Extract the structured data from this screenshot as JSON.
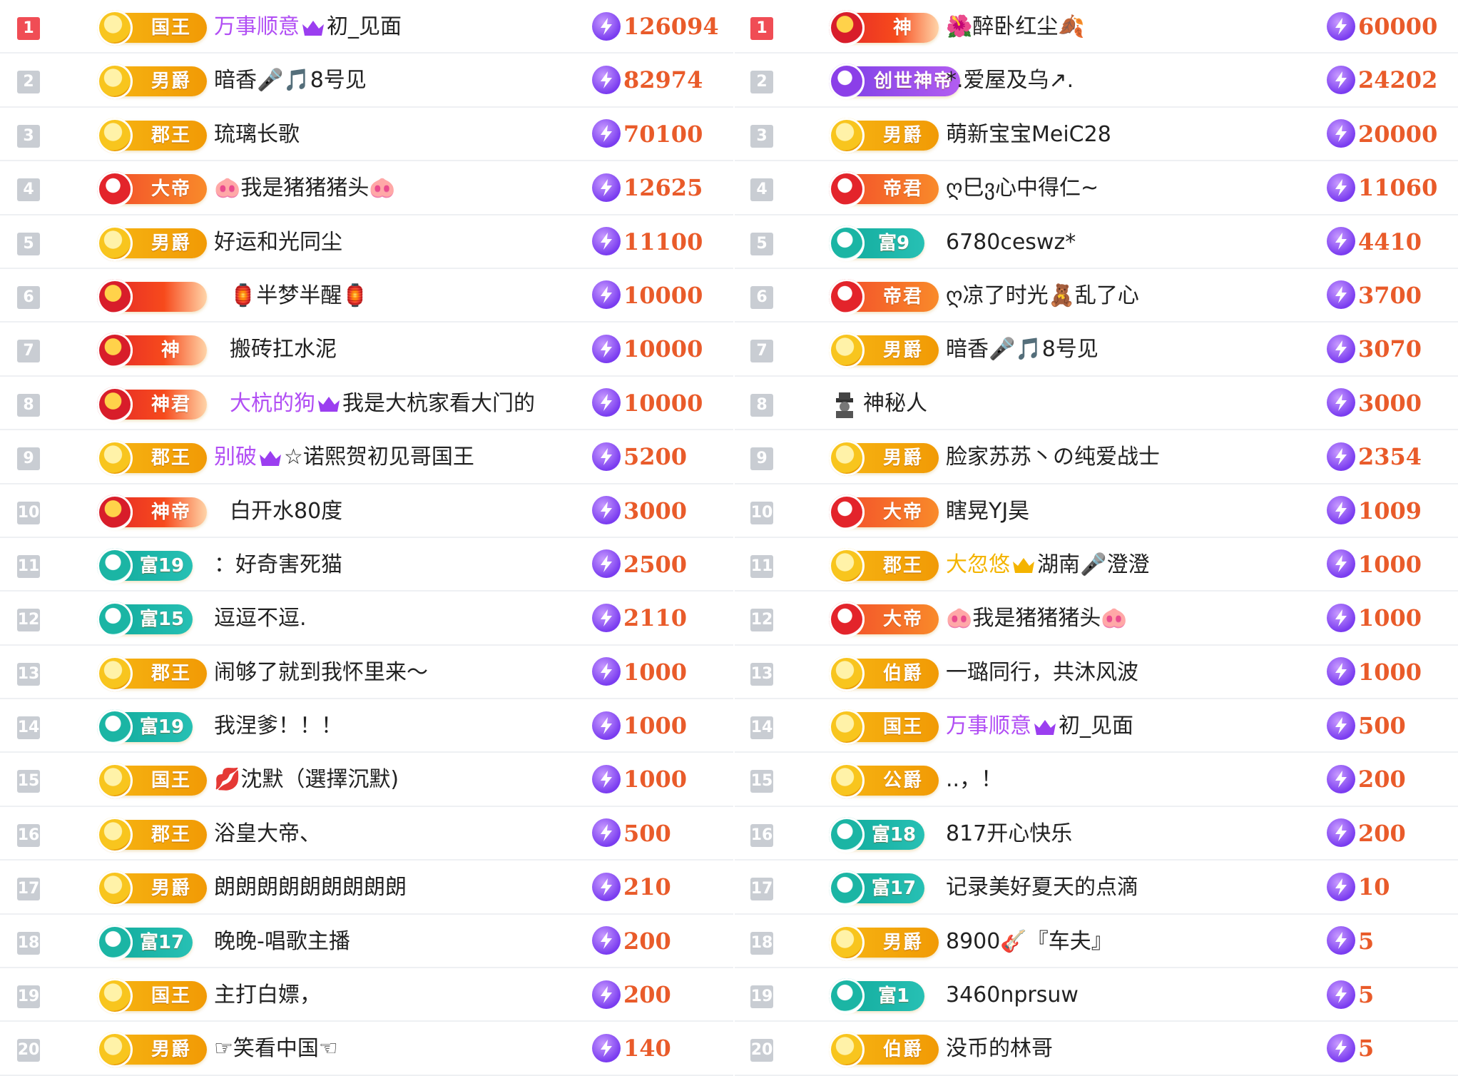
{
  "left": [
    {
      "rank": "1",
      "badge": "国王",
      "style": "gold",
      "name": "初_见面",
      "prefix": "万事顺意",
      "crown": true,
      "score": "126094",
      "top": true
    },
    {
      "rank": "2",
      "badge": "男爵",
      "style": "gold",
      "name": "暗香🎤🎵8号见",
      "score": "82974"
    },
    {
      "rank": "3",
      "badge": "郡王",
      "style": "gold",
      "name": "琉璃长歌",
      "score": "70100"
    },
    {
      "rank": "4",
      "badge": "大帝",
      "style": "red",
      "name": "🐽我是猪猪猪头🐽",
      "score": "12625"
    },
    {
      "rank": "5",
      "badge": "男爵",
      "style": "gold",
      "name": "好运和光同尘",
      "score": "11100"
    },
    {
      "rank": "6",
      "badge": "",
      "style": "red2",
      "name": "🏮半梦半醒🏮",
      "score": "10000",
      "shift": true
    },
    {
      "rank": "7",
      "badge": "神",
      "style": "red2",
      "name": "搬砖扛水泥",
      "score": "10000",
      "shift": true
    },
    {
      "rank": "8",
      "badge": "神君",
      "style": "red2",
      "name": "我是大杭家看大门的",
      "prefix": "大杭的狗",
      "crown": true,
      "score": "10000",
      "shift": true
    },
    {
      "rank": "9",
      "badge": "郡王",
      "style": "gold",
      "name": "☆诺熙贺初见哥国王",
      "prefix": "别破",
      "crown": true,
      "score": "5200"
    },
    {
      "rank": "10",
      "badge": "神帝",
      "style": "red2",
      "name": "白开水80度",
      "score": "3000",
      "shift": true
    },
    {
      "rank": "11",
      "badge": "富19",
      "style": "green",
      "name": "：好奇害死猫",
      "score": "2500"
    },
    {
      "rank": "12",
      "badge": "富15",
      "style": "green",
      "name": "逗逗不逗.",
      "score": "2110"
    },
    {
      "rank": "13",
      "badge": "郡王",
      "style": "gold",
      "name": "闹够了就到我怀里来～",
      "score": "1000"
    },
    {
      "rank": "14",
      "badge": "富19",
      "style": "green",
      "name": "我涅爹！！！",
      "score": "1000"
    },
    {
      "rank": "15",
      "badge": "国王",
      "style": "gold",
      "name": "💋沈默（選擇沉默)",
      "score": "1000"
    },
    {
      "rank": "16",
      "badge": "郡王",
      "style": "gold",
      "name": "浴皇大帝、",
      "score": "500"
    },
    {
      "rank": "17",
      "badge": "男爵",
      "style": "gold",
      "name": "朗朗朗朗朗朗朗朗朗",
      "score": "210"
    },
    {
      "rank": "18",
      "badge": "富17",
      "style": "green",
      "name": "晚晚-唱歌主播",
      "score": "200"
    },
    {
      "rank": "19",
      "badge": "国王",
      "style": "gold",
      "name": "主打白嫖，",
      "score": "200"
    },
    {
      "rank": "20",
      "badge": "男爵",
      "style": "gold",
      "name": "☞笑看中国☜",
      "score": "140"
    }
  ],
  "right": [
    {
      "rank": "1",
      "badge": "神",
      "style": "red2",
      "name": "🌺醉卧红尘🍂",
      "score": "60000",
      "top": true,
      "shift": true
    },
    {
      "rank": "2",
      "badge": "创世神帝",
      "style": "purple",
      "name": "*.爱屋及乌↗.",
      "score": "24202",
      "shift": true
    },
    {
      "rank": "3",
      "badge": "男爵",
      "style": "gold",
      "name": "萌新宝宝MeiC28",
      "score": "20000"
    },
    {
      "rank": "4",
      "badge": "帝君",
      "style": "red",
      "name": "ღ巳ვ心中得仁~",
      "score": "11060"
    },
    {
      "rank": "5",
      "badge": "富9",
      "style": "green",
      "name": "6780ceswz*",
      "score": "4410"
    },
    {
      "rank": "6",
      "badge": "帝君",
      "style": "red",
      "name": "ღ凉了时光🧸乱了心",
      "score": "3700"
    },
    {
      "rank": "7",
      "badge": "男爵",
      "style": "gold",
      "name": "暗香🎤🎵8号见",
      "score": "3070"
    },
    {
      "rank": "8",
      "badge": "",
      "style": "none",
      "name": "神秘人",
      "score": "3000",
      "wide": true
    },
    {
      "rank": "9",
      "badge": "男爵",
      "style": "gold",
      "name": "脸家苏苏丶の纯爱战士",
      "score": "2354"
    },
    {
      "rank": "10",
      "badge": "大帝",
      "style": "red",
      "name": "瞎晃YJ昊",
      "score": "1009"
    },
    {
      "rank": "11",
      "badge": "郡王",
      "style": "gold",
      "name": "湖南🎤澄澄",
      "prefix": "大忽悠",
      "crown": true,
      "goldprefix": true,
      "score": "1000"
    },
    {
      "rank": "12",
      "badge": "大帝",
      "style": "red",
      "name": "🐽我是猪猪猪头🐽",
      "score": "1000"
    },
    {
      "rank": "13",
      "badge": "伯爵",
      "style": "gold",
      "name": "一璐同行，共沐风波",
      "score": "1000"
    },
    {
      "rank": "14",
      "badge": "国王",
      "style": "gold",
      "name": "初_见面",
      "prefix": "万事顺意",
      "crown": true,
      "score": "500"
    },
    {
      "rank": "15",
      "badge": "公爵",
      "style": "gold",
      "name": "..，！",
      "score": "200"
    },
    {
      "rank": "16",
      "badge": "富18",
      "style": "green",
      "name": "817开心快乐",
      "score": "200"
    },
    {
      "rank": "17",
      "badge": "富17",
      "style": "green",
      "name": "记录美好夏天的点滴",
      "score": "10"
    },
    {
      "rank": "18",
      "badge": "男爵",
      "style": "gold",
      "name": "8900🎸『车夫』",
      "score": "5"
    },
    {
      "rank": "19",
      "badge": "富1",
      "style": "green",
      "name": "3460nprsuw",
      "score": "5"
    },
    {
      "rank": "20",
      "badge": "伯爵",
      "style": "gold",
      "name": "没币的林哥",
      "score": "5"
    }
  ]
}
